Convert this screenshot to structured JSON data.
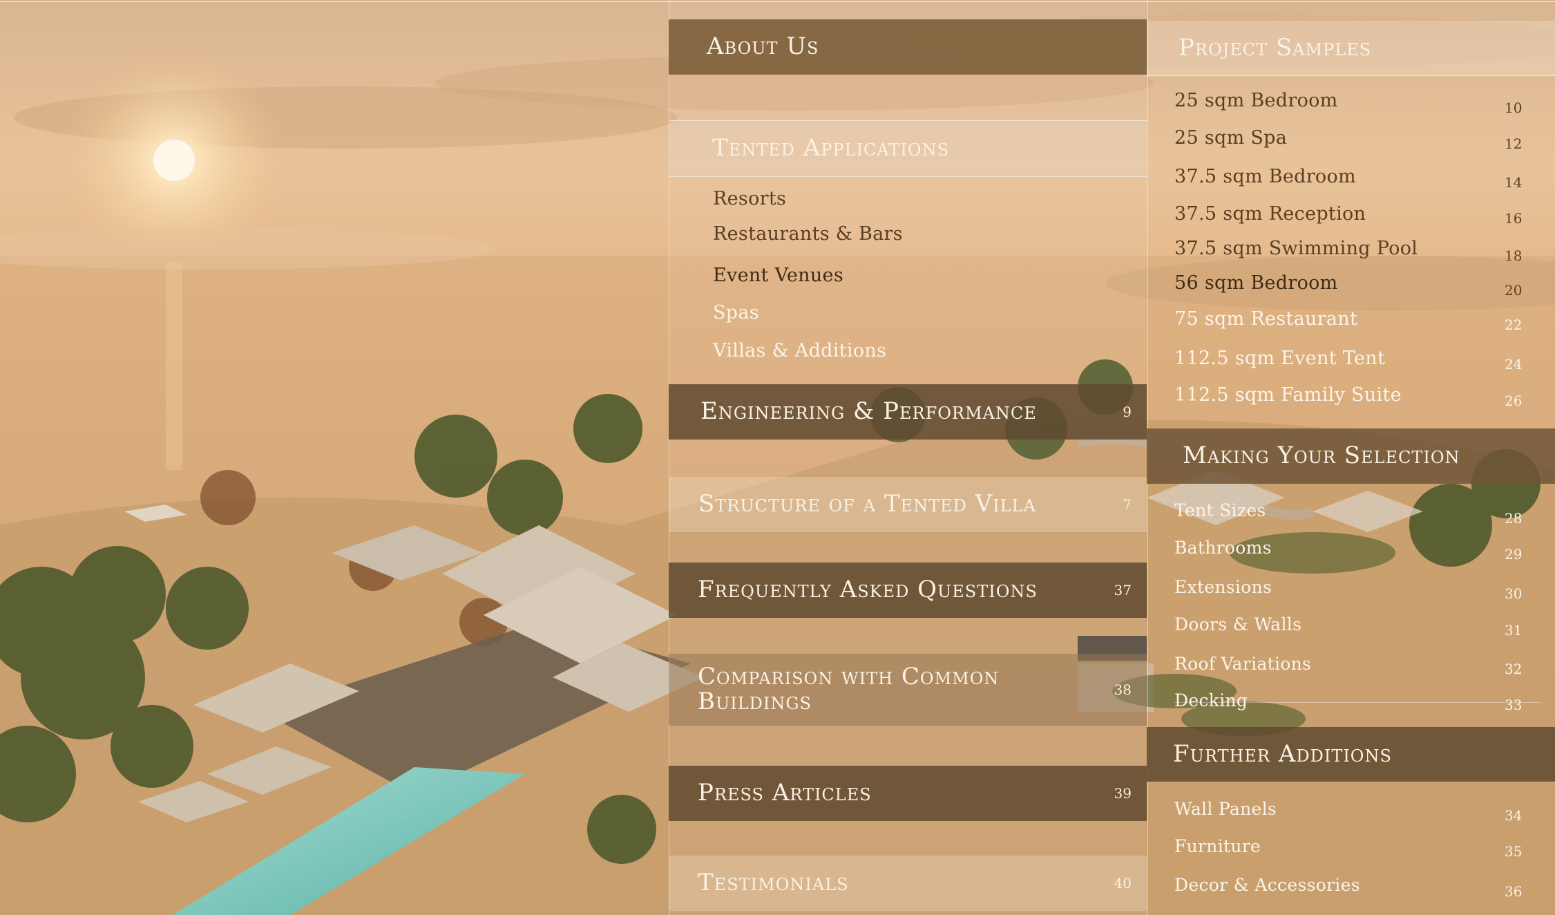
{
  "middle": {
    "about": {
      "label": "About Us"
    },
    "tented": {
      "label": "Tented Applications",
      "items": [
        "Resorts",
        "Restaurants & Bars",
        "Event Venues",
        "Spas",
        "Villas & Additions"
      ]
    },
    "engineering": {
      "label": "Engineering & Performance",
      "page": "9"
    },
    "structure": {
      "label": "Structure of a Tented Villa",
      "page": "7"
    },
    "faq": {
      "label": "Frequently Asked Questions",
      "page": "37"
    },
    "comparison": {
      "label_line1": "Comparison with Common",
      "label_line2": "Buildings",
      "page": "38"
    },
    "press": {
      "label": "Press Articles",
      "page": "39"
    },
    "testimonials": {
      "label": "Testimonials",
      "page": "40"
    }
  },
  "right": {
    "samples": {
      "label": "Project Samples",
      "items": [
        {
          "label": "25 sqm Bedroom",
          "page": "10"
        },
        {
          "label": "25 sqm Spa",
          "page": "12"
        },
        {
          "label": "37.5 sqm Bedroom",
          "page": "14"
        },
        {
          "label": "37.5 sqm Reception",
          "page": "16"
        },
        {
          "label": "37.5 sqm Swimming Pool",
          "page": "18"
        },
        {
          "label": "56 sqm Bedroom",
          "page": "20"
        },
        {
          "label": "75 sqm Restaurant",
          "page": "22"
        },
        {
          "label": "112.5 sqm Event Tent",
          "page": "24"
        },
        {
          "label": "112.5 sqm Family Suite",
          "page": "26"
        }
      ]
    },
    "selection": {
      "label": "Making Your Selection",
      "items": [
        {
          "label": "Tent Sizes",
          "page": "28"
        },
        {
          "label": "Bathrooms",
          "page": "29"
        },
        {
          "label": "Extensions",
          "page": "30"
        },
        {
          "label": "Doors & Walls",
          "page": "31"
        },
        {
          "label": "Roof Variations",
          "page": "32"
        },
        {
          "label": "Decking",
          "page": "33"
        }
      ]
    },
    "further": {
      "label": "Further Additions",
      "items": [
        {
          "label": "Wall Panels",
          "page": "34"
        },
        {
          "label": "Furniture",
          "page": "35"
        },
        {
          "label": "Decor & Accessories",
          "page": "36"
        }
      ]
    }
  },
  "colors": {
    "band_dark": "#7a5c38",
    "text_dark": "#5a3e22",
    "text_light": "#fbf4ea",
    "sky": "#e6b987",
    "sand": "#c49a6c"
  }
}
